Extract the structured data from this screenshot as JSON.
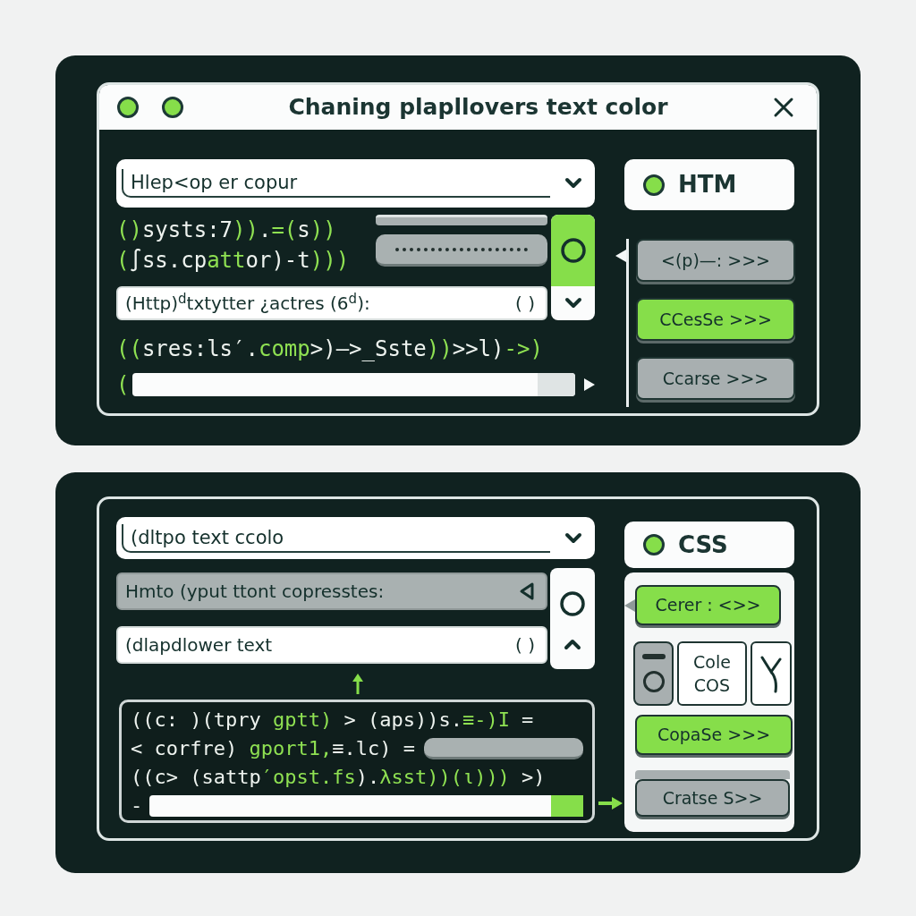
{
  "top_window": {
    "title": "Chaning plapllovers text color",
    "dropdown": {
      "value": "Hlep<op er copur"
    },
    "code_lines_upper": [
      [
        {
          "text": "()",
          "color": "#8fe152"
        },
        {
          "text": "systs:7",
          "color": "#eef3ef"
        },
        {
          "text": "))",
          "color": "#8fe152"
        },
        {
          "text": ".",
          "color": "#eef3ef"
        },
        {
          "text": "=(",
          "color": "#8fe152"
        },
        {
          "text": "s",
          "color": "#eef3ef"
        },
        {
          "text": "))",
          "color": "#8fe152"
        }
      ],
      [
        {
          "text": "(",
          "color": "#8fe152"
        },
        {
          "text": "∫ss.cp",
          "color": "#eef3ef"
        },
        {
          "text": "att",
          "color": "#8fe152"
        },
        {
          "text": "or)-t",
          "color": "#eef3ef"
        },
        {
          "text": ")))",
          "color": "#8fe152"
        }
      ]
    ],
    "field": {
      "value": "(Http)$^{d}$txtytter ¿actres (6$^{d}$):",
      "suffix": "( )"
    },
    "code_lines_lower": [
      [
        {
          "text": "((",
          "color": "#8fe152"
        },
        {
          "text": "sres:ls′.",
          "color": "#eef3ef"
        },
        {
          "text": "comp",
          "color": "#8fe152"
        },
        {
          "text": ">)—>_Sste",
          "color": "#eef3ef"
        },
        {
          "text": "))",
          "color": "#8fe152"
        },
        {
          "text": ">>l)",
          "color": "#eef3ef"
        },
        {
          "text": "->)",
          "color": "#8fe152"
        }
      ],
      [
        {
          "text": "(",
          "color": "#8fe152"
        }
      ]
    ],
    "language": {
      "label": "HTM"
    },
    "buttons": [
      {
        "label": "<(p)—: >>>",
        "selected": false
      },
      {
        "label": "CCesSe >>>",
        "selected": true
      },
      {
        "label": "Ccarse >>>",
        "selected": false
      }
    ]
  },
  "bottom_window": {
    "dropdown": {
      "value": "(dltpo text ccolo"
    },
    "input_field": {
      "value": "Hmto (yput ttont copresstes:"
    },
    "field": {
      "value": "(dlapdlower text",
      "suffix": "( )"
    },
    "code_lines": [
      [
        {
          "text": "((c: )(tpry ",
          "color": "#eef3ef"
        },
        {
          "text": "gptt)",
          "color": "#8fe152"
        },
        {
          "text": " > (aps))s.",
          "color": "#eef3ef"
        },
        {
          "text": "≡-)I",
          "color": "#8fe152"
        },
        {
          "text": " =",
          "color": "#eef3ef"
        }
      ],
      [
        {
          "text": "< corfre) ",
          "color": "#eef3ef"
        },
        {
          "text": "gport1,",
          "color": "#8fe152"
        },
        {
          "text": "≡.lc) =",
          "color": "#eef3ef"
        }
      ],
      [
        {
          "text": "((c> (sattp",
          "color": "#eef3ef"
        },
        {
          "text": "′opst.fs",
          "color": "#8fe152"
        },
        {
          "text": ").",
          "color": "#eef3ef"
        },
        {
          "text": "λsst))(ι)))",
          "color": "#8fe152"
        },
        {
          "text": " >)",
          "color": "#eef3ef"
        }
      ],
      [
        {
          "text": "-",
          "color": "#eef3ef"
        }
      ]
    ],
    "language": {
      "label": "CSS"
    },
    "buttons": [
      {
        "label": "Cerer : <>>",
        "selected": true
      }
    ],
    "option": {
      "label": "Cole COS"
    },
    "more_buttons": [
      {
        "label": "CopaSe >>>",
        "selected": true
      },
      {
        "label": "Cratse S>>",
        "selected": false
      }
    ]
  }
}
